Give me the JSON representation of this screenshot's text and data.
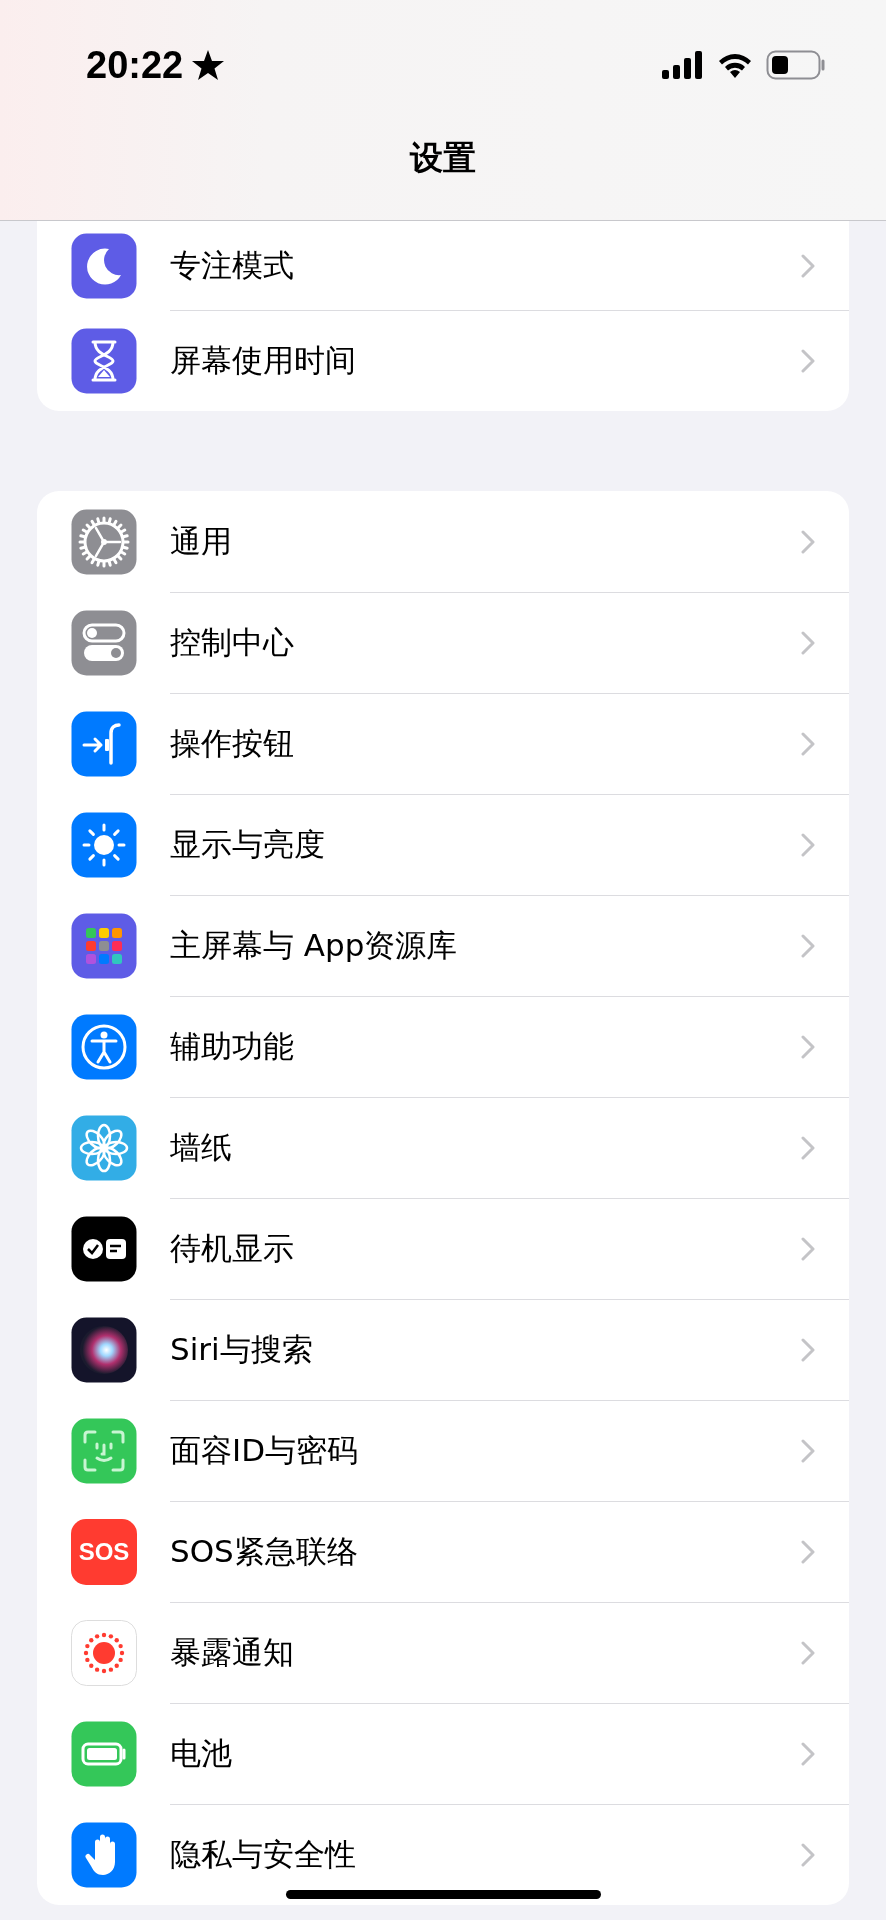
{
  "status_bar": {
    "time": "20:22"
  },
  "title": "设置",
  "groups": [
    {
      "items": [
        {
          "label": "专注模式"
        },
        {
          "label": "屏幕使用时间"
        }
      ]
    },
    {
      "items": [
        {
          "label": "通用"
        },
        {
          "label": "控制中心"
        },
        {
          "label": "操作按钮"
        },
        {
          "label": "显示与亮度"
        },
        {
          "label": "主屏幕与 App资源库"
        },
        {
          "label": "辅助功能"
        },
        {
          "label": "墙纸"
        },
        {
          "label": "待机显示"
        },
        {
          "label": "Siri与搜索"
        },
        {
          "label": "面容ID与密码"
        },
        {
          "label": "SOS紧急联络",
          "icon_text": "SOS"
        },
        {
          "label": "暴露通知"
        },
        {
          "label": "电池"
        },
        {
          "label": "隐私与安全性"
        }
      ]
    }
  ]
}
